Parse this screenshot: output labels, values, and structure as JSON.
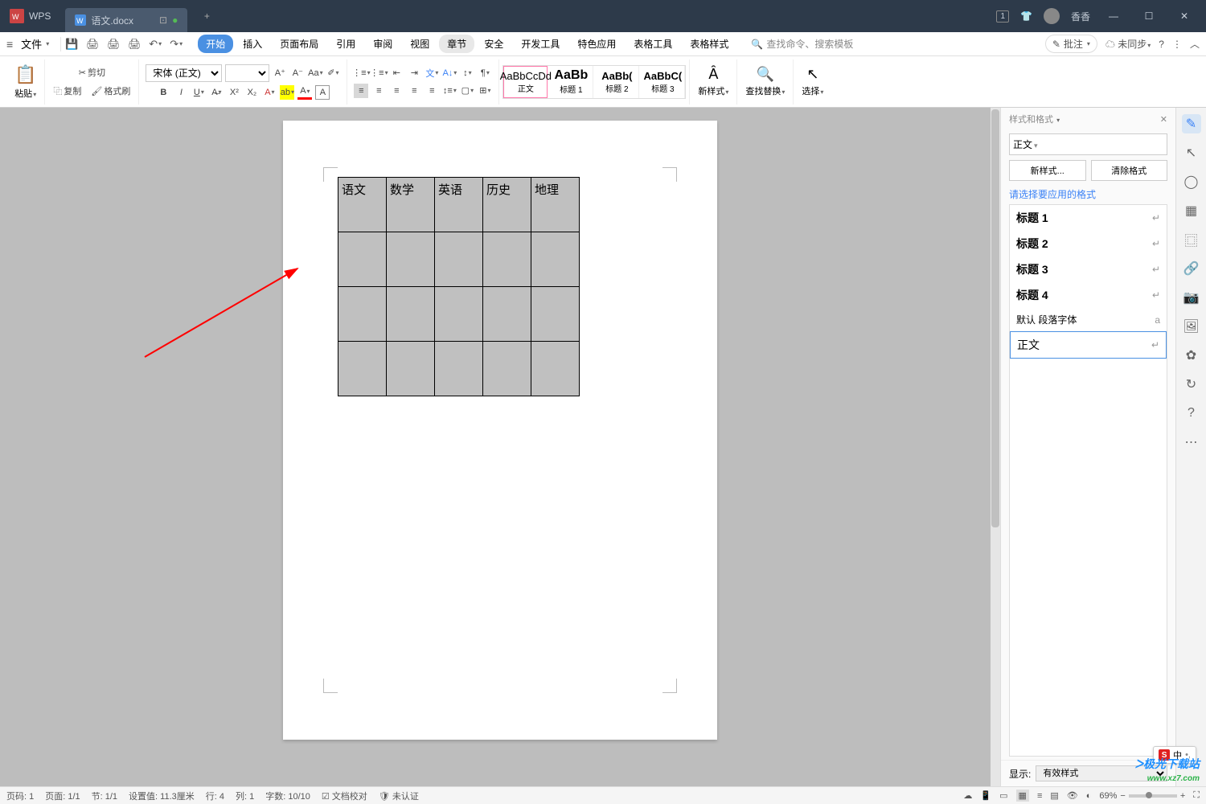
{
  "app": {
    "name": "WPS",
    "user": "香香"
  },
  "tab": {
    "filename": "语文.docx"
  },
  "menu": {
    "file": "文件",
    "tabs": [
      "开始",
      "插入",
      "页面布局",
      "引用",
      "审阅",
      "视图",
      "章节",
      "安全",
      "开发工具",
      "特色应用",
      "表格工具",
      "表格样式"
    ],
    "active_tab": "开始",
    "gray_tab": "章节",
    "search_placeholder": "查找命令、搜索模板"
  },
  "menubar_right": {
    "annotate": "批注",
    "sync": "未同步"
  },
  "ribbon": {
    "paste": "粘贴",
    "cut": "剪切",
    "copy": "复制",
    "format_painter": "格式刷",
    "font_name": "宋体 (正文)",
    "font_size": "",
    "styles": [
      {
        "preview": "AaBbCcDd",
        "label": "正文"
      },
      {
        "preview": "AaBb",
        "label": "标题 1"
      },
      {
        "preview": "AaBb(",
        "label": "标题 2"
      },
      {
        "preview": "AaBbC(",
        "label": "标题 3"
      }
    ],
    "new_style": "新样式",
    "find_replace": "查找替换",
    "select": "选择"
  },
  "table": {
    "headers": [
      "语文",
      "数学",
      "英语",
      "历史",
      "地理"
    ],
    "rows": 4
  },
  "panel": {
    "title": "样式和格式",
    "current_style": "正文",
    "new_style_btn": "新样式...",
    "clear_btn": "清除格式",
    "prompt": "请选择要应用的格式",
    "items": [
      {
        "label": "标题 1",
        "mark": "↵",
        "bold": true
      },
      {
        "label": "标题 2",
        "mark": "↵",
        "bold": true
      },
      {
        "label": "标题 3",
        "mark": "↵",
        "bold": true
      },
      {
        "label": "标题 4",
        "mark": "↵",
        "bold": true
      },
      {
        "label": "默认 段落字体",
        "mark": "a",
        "bold": false
      },
      {
        "label": "正文",
        "mark": "↵",
        "bold": false,
        "selected": true
      }
    ],
    "show_label": "显示:",
    "show_value": "有效样式"
  },
  "status": {
    "page_no": "页码: 1",
    "page": "页面: 1/1",
    "section": "节: 1/1",
    "setvalue": "设置值: 11.3厘米",
    "line": "行: 4",
    "col": "列: 1",
    "words": "字数: 10/10",
    "proof": "文档校对",
    "auth": "未认证",
    "zoom": "69%"
  }
}
